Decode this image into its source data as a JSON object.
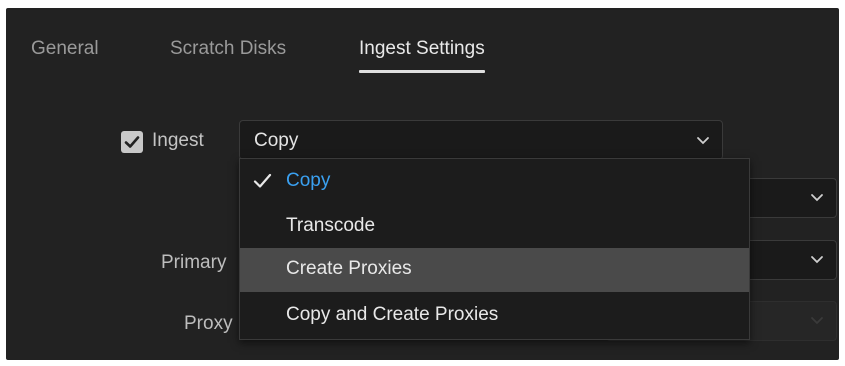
{
  "tabs": [
    {
      "label": "General",
      "active": false
    },
    {
      "label": "Scratch Disks",
      "active": false
    },
    {
      "label": "Ingest Settings",
      "active": true
    }
  ],
  "ingest": {
    "checkbox_checked": true,
    "label": "Ingest",
    "selected_value": "Copy"
  },
  "dropdown": {
    "items": [
      {
        "label": "Copy",
        "selected": true
      },
      {
        "label": "Transcode",
        "selected": false
      },
      {
        "label": "Create Proxies",
        "selected": false,
        "highlighted": true
      },
      {
        "label": "Copy and Create Proxies",
        "selected": false
      }
    ]
  },
  "fields": {
    "primary_label": "Primary",
    "proxy_label": "Proxy"
  },
  "icons": {
    "checkbox": "checkmark-icon",
    "dropdown": "chevron-down-icon",
    "selected_item": "checkmark-icon"
  },
  "colors": {
    "panel_bg": "#222222",
    "accent_selected": "#3aa0f0",
    "highlight_row": "#4a4a4a"
  }
}
